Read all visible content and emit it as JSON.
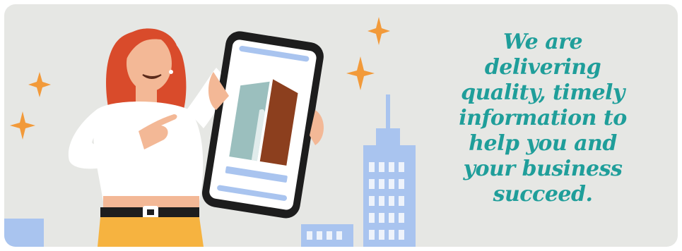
{
  "banner": {
    "headline_lines": [
      "We are",
      "delivering",
      "quality, timely",
      "information to",
      "help you and",
      "your business",
      "succeed."
    ],
    "colors": {
      "background": "#e6e7e4",
      "headline": "#1f9e9a",
      "sparkle": "#f29a3a",
      "buildings": "#a9c4ef",
      "hair": "#d94b2b",
      "phone_frame": "#1d1d1d",
      "logo_teal": "#9bbfbe",
      "logo_brown": "#8c3f1e"
    },
    "icons": [
      "sparkle-icon",
      "phone-logo-icon"
    ]
  }
}
